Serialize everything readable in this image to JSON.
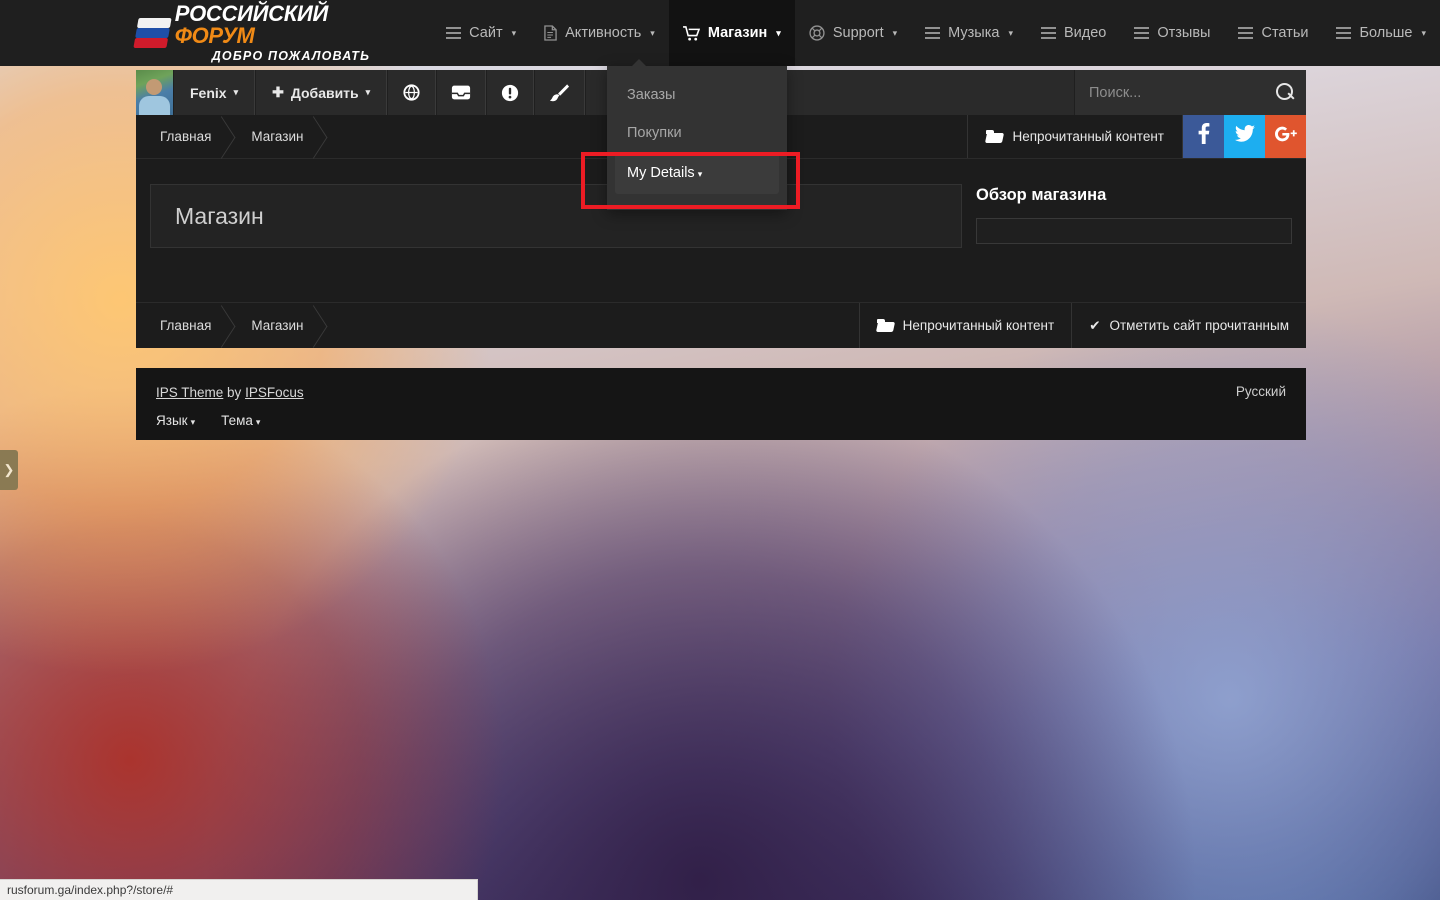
{
  "site": {
    "logo_line1_white": "РОССИЙСКИЙ ",
    "logo_line1_orange": "ФОРУМ",
    "logo_line2": "ДОБРО ПОЖАЛОВАТЬ"
  },
  "mainnav": [
    {
      "label": "Сайт",
      "icon": "bars-icon",
      "caret": "▾",
      "active": false
    },
    {
      "label": "Активность",
      "icon": "document-icon",
      "caret": "▾",
      "active": false
    },
    {
      "label": "Магазин",
      "icon": "cart-icon",
      "caret": "▾",
      "active": true
    },
    {
      "label": "Support",
      "icon": "lifebuoy-icon",
      "caret": "▾",
      "active": false
    },
    {
      "label": "Музыка",
      "icon": "bars-icon",
      "caret": "▾",
      "active": false
    },
    {
      "label": "Видео",
      "icon": "bars-icon",
      "caret": "",
      "active": false
    },
    {
      "label": "Отзывы",
      "icon": "bars-icon",
      "caret": "",
      "active": false
    },
    {
      "label": "Статьи",
      "icon": "bars-icon",
      "caret": "",
      "active": false
    },
    {
      "label": "Больше",
      "icon": "bars-icon",
      "caret": "▾",
      "active": false
    }
  ],
  "dropdown": {
    "items": [
      {
        "label": "Заказы",
        "selected": false,
        "caret": ""
      },
      {
        "label": "Покупки",
        "selected": false,
        "caret": ""
      },
      {
        "label": "My Details",
        "selected": true,
        "caret": "▾"
      }
    ],
    "highlight_color": "#ed1c24"
  },
  "userbar": {
    "username": "Fenix",
    "username_caret": "▾",
    "add_label": "Добавить",
    "add_plus": "✚",
    "add_caret": "▾",
    "icons": [
      {
        "name": "globe-icon",
        "glyph": "🌐"
      },
      {
        "name": "inbox-icon",
        "glyph": "▭"
      },
      {
        "name": "warning-icon",
        "glyph": "❗"
      },
      {
        "name": "brush-icon",
        "glyph": "🖌"
      }
    ]
  },
  "search": {
    "placeholder": "Поиск...",
    "value": ""
  },
  "breadcrumb_top": [
    "Главная",
    "Магазин"
  ],
  "breadcrumb_bottom": [
    "Главная",
    "Магазин"
  ],
  "actions": {
    "unread_top": "Непрочитанный контент",
    "unread_bottom": "Непрочитанный контент",
    "mark_read": "Отметить сайт прочитанным",
    "mark_read_check": "✔"
  },
  "social": [
    {
      "name": "facebook-button",
      "glyph": "f",
      "color": "#3b5998"
    },
    {
      "name": "twitter-button",
      "glyph": "🐦",
      "color": "#1daef0"
    },
    {
      "name": "googleplus-button",
      "glyph": "G+",
      "color": "#e0552e"
    }
  ],
  "main": {
    "page_title": "Магазин",
    "sidebar_heading": "Обзор магазина",
    "sidebar_field_value": ""
  },
  "footer": {
    "theme_link": "IPS Theme",
    "by": " by ",
    "author_link": "IPSFocus",
    "language_label": "Язык",
    "theme_label": "Тема",
    "caret": "▾",
    "current_language": "Русский"
  },
  "side_tab": {
    "glyph": "❯"
  },
  "status_bar": {
    "url": "rusforum.ga/index.php?/store/#"
  }
}
